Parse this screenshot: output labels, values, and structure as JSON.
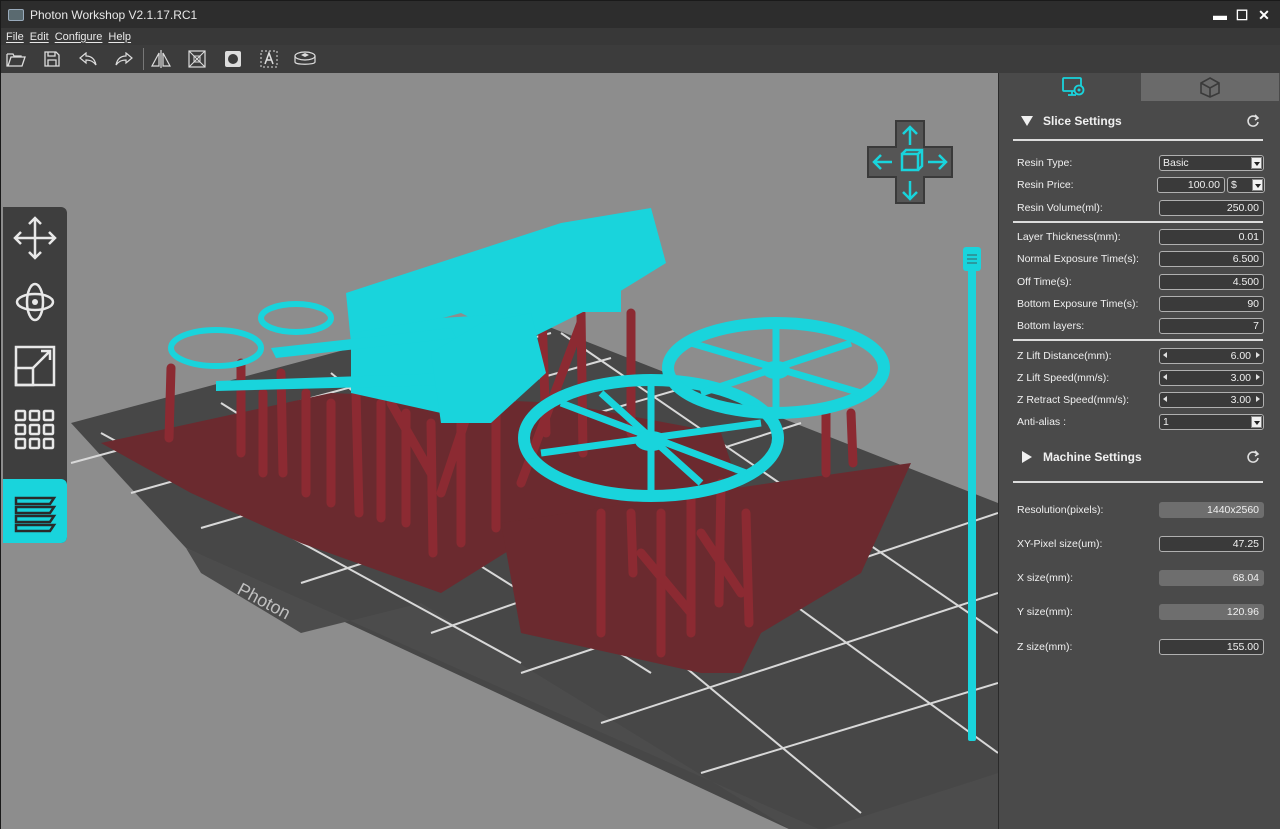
{
  "window": {
    "title": "Photon Workshop V2.1.17.RC1",
    "minimize": "▬",
    "maximize": "☐",
    "close": "✕"
  },
  "menu": [
    "File",
    "Edit",
    "Configure",
    "Help"
  ],
  "toolbar": {
    "icons": [
      "open-folder-icon",
      "save-icon",
      "undo-icon",
      "redo-icon",
      "mirror-icon",
      "hollow-icon",
      "punch-hole-icon",
      "text-icon",
      "box-icon"
    ]
  },
  "viewport": {
    "plate_label": "Photon",
    "model_color": "#19d4dc",
    "support_color": "#8c2a32",
    "left_tools": [
      "move-icon",
      "rotate-icon",
      "scale-icon",
      "multiply-icon",
      "layers-icon"
    ]
  },
  "panel": {
    "tabs": [
      "settings-icon",
      "model-icon"
    ],
    "slice_settings": {
      "title": "Slice Settings",
      "rows": [
        {
          "label": "Resin Type:",
          "value": "Basic"
        },
        {
          "label": "Resin Price:",
          "value": "100.00",
          "unit": "$"
        },
        {
          "label": "Resin Volume(ml):",
          "value": "250.00"
        },
        {
          "label": "Layer Thickness(mm):",
          "value": "0.01"
        },
        {
          "label": "Normal Exposure Time(s):",
          "value": "6.500"
        },
        {
          "label": "Off Time(s):",
          "value": "4.500"
        },
        {
          "label": "Bottom Exposure Time(s):",
          "value": "90"
        },
        {
          "label": "Bottom layers:",
          "value": "7"
        },
        {
          "label": "Z Lift Distance(mm):",
          "value": "6.00"
        },
        {
          "label": "Z Lift Speed(mm/s):",
          "value": "3.00"
        },
        {
          "label": "Z Retract Speed(mm/s):",
          "value": "3.00"
        },
        {
          "label": "Anti-alias :",
          "value": "1"
        }
      ]
    },
    "machine_settings": {
      "title": "Machine Settings",
      "rows": [
        {
          "label": "Resolution(pixels):",
          "value": "1440x2560"
        },
        {
          "label": "XY-Pixel size(um):",
          "value": "47.25"
        },
        {
          "label": "X size(mm):",
          "value": "68.04"
        },
        {
          "label": "Y size(mm):",
          "value": "120.96"
        },
        {
          "label": "Z size(mm):",
          "value": "155.00"
        }
      ]
    }
  }
}
